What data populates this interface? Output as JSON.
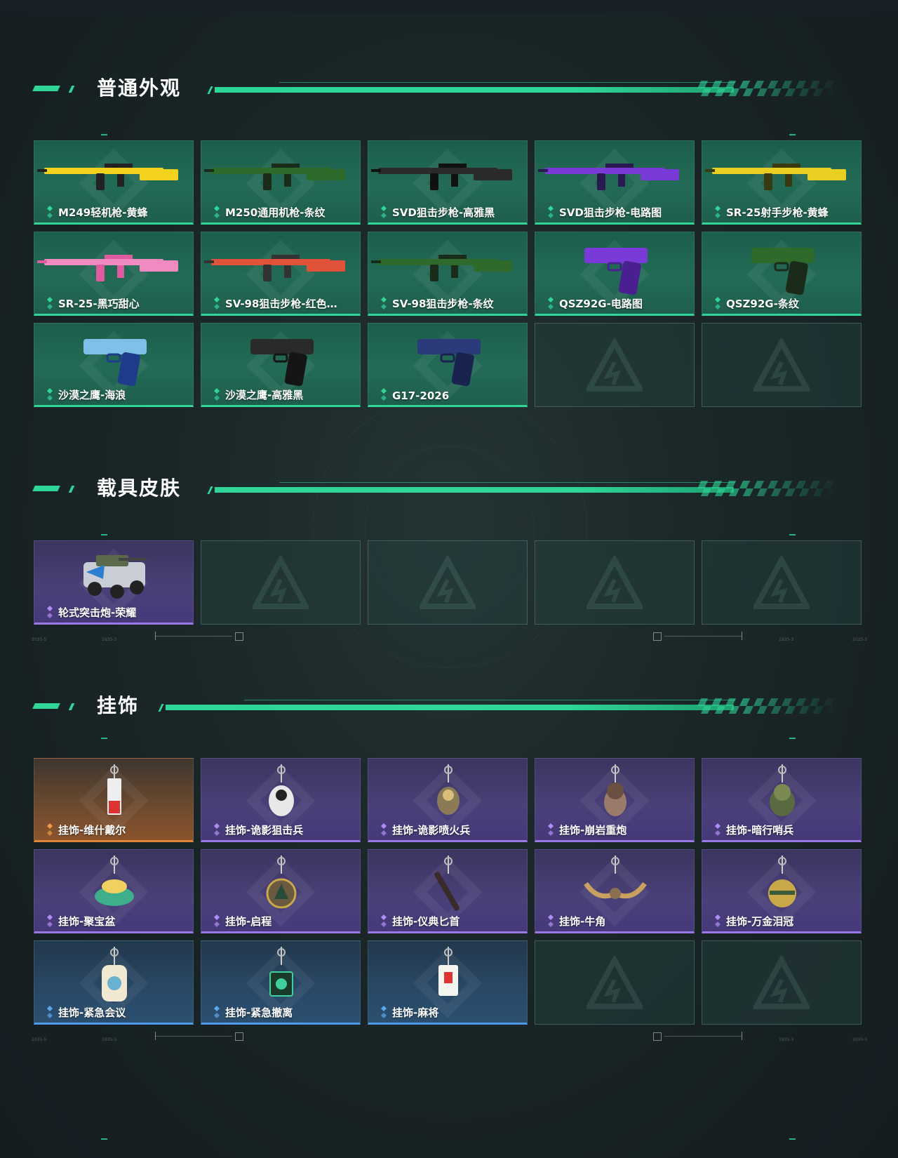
{
  "sections": [
    {
      "title": "普通外观",
      "items": [
        {
          "label": "M249轻机枪-黄蜂",
          "rarity": "green",
          "art": "lmg-yellow"
        },
        {
          "label": "M250通用机枪-条纹",
          "rarity": "green",
          "art": "lmg-camo"
        },
        {
          "label": "SVD狙击步枪-高雅黑",
          "rarity": "green",
          "art": "sniper-black"
        },
        {
          "label": "SVD狙击步枪-电路图",
          "rarity": "green",
          "art": "sniper-purple"
        },
        {
          "label": "SR-25射手步枪-黄蜂",
          "rarity": "green",
          "art": "dmr-yellow"
        },
        {
          "label": "SR-25-黑巧甜心",
          "rarity": "green",
          "art": "dmr-pink"
        },
        {
          "label": "SV-98狙击步枪-红色…",
          "rarity": "green",
          "art": "bolt-red"
        },
        {
          "label": "SV-98狙击步枪-条纹",
          "rarity": "green",
          "art": "bolt-camo"
        },
        {
          "label": "QSZ92G-电路图",
          "rarity": "green",
          "art": "pistol-purple"
        },
        {
          "label": "QSZ92G-条纹",
          "rarity": "green",
          "art": "pistol-camo"
        },
        {
          "label": "沙漠之鹰-海浪",
          "rarity": "green",
          "art": "deagle-wave"
        },
        {
          "label": "沙漠之鹰-高雅黑",
          "rarity": "green",
          "art": "deagle-black"
        },
        {
          "label": "G17-2026",
          "rarity": "green",
          "art": "glock-blue"
        },
        {
          "label": "",
          "rarity": "empty",
          "art": ""
        },
        {
          "label": "",
          "rarity": "empty",
          "art": ""
        }
      ]
    },
    {
      "title": "载具皮肤",
      "items": [
        {
          "label": "轮式突击炮-荣耀",
          "rarity": "purple",
          "art": "vehicle"
        },
        {
          "label": "",
          "rarity": "empty",
          "art": ""
        },
        {
          "label": "",
          "rarity": "empty",
          "art": ""
        },
        {
          "label": "",
          "rarity": "empty",
          "art": ""
        },
        {
          "label": "",
          "rarity": "empty",
          "art": ""
        }
      ]
    },
    {
      "title": "挂饰",
      "items": [
        {
          "label": "挂饰-维什戴尔",
          "rarity": "orange",
          "art": "charm-tag"
        },
        {
          "label": "挂饰-诡影狙击兵",
          "rarity": "purple",
          "art": "charm-ghost"
        },
        {
          "label": "挂饰-诡影喷火兵",
          "rarity": "purple",
          "art": "charm-ghost2"
        },
        {
          "label": "挂饰-崩岩重炮",
          "rarity": "purple",
          "art": "charm-figure"
        },
        {
          "label": "挂饰-暗行哨兵",
          "rarity": "purple",
          "art": "charm-soldier"
        },
        {
          "label": "挂饰-聚宝盆",
          "rarity": "purple",
          "art": "charm-bowl"
        },
        {
          "label": "挂饰-启程",
          "rarity": "purple",
          "art": "charm-medal"
        },
        {
          "label": "挂饰-仪典匕首",
          "rarity": "purple",
          "art": "charm-dagger"
        },
        {
          "label": "挂饰-牛角",
          "rarity": "purple",
          "art": "charm-horn"
        },
        {
          "label": "挂饰-万金泪冠",
          "rarity": "purple",
          "art": "charm-coin"
        },
        {
          "label": "挂饰-紧急会议",
          "rarity": "blue",
          "art": "charm-meeting"
        },
        {
          "label": "挂饰-紧急撤离",
          "rarity": "blue",
          "art": "charm-evac"
        },
        {
          "label": "挂饰-麻将",
          "rarity": "blue",
          "art": "charm-mahjong"
        },
        {
          "label": "",
          "rarity": "empty",
          "art": ""
        },
        {
          "label": "",
          "rarity": "empty",
          "art": ""
        }
      ]
    }
  ],
  "deco": {
    "code_left": "2035-5",
    "code_mid": "1935-3",
    "code_right": "2035-5"
  },
  "colors": {
    "accent": "#2fd698",
    "green_card": "#236b56",
    "purple_card": "#4a4078",
    "orange_card": "#8a542d",
    "blue_card": "#2a4866"
  }
}
